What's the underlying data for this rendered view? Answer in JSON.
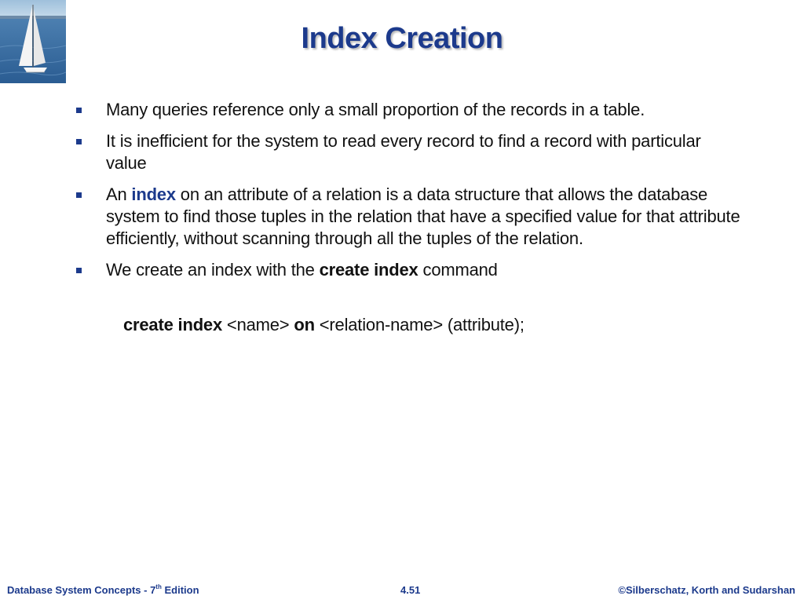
{
  "colors": {
    "title": "#1c3a8c",
    "bullet_marker": "#1c3a8c",
    "keyword_blue": "#1c3a8c",
    "footer": "#1c3a8c",
    "text": "#111111"
  },
  "slide": {
    "title": "Index Creation",
    "bullets": [
      {
        "text": "Many queries reference only a small proportion of the records in a table."
      },
      {
        "text": "It is inefficient for the system to read every record to find  a record with particular value"
      },
      {
        "pre": "An ",
        "keyword": "index",
        "post": " on an attribute of a relation is a data structure that allows the database system to find those tuples in the relation that have a specified value for that attribute efficiently, without scanning through all the tuples of the relation."
      },
      {
        "pre": "We create an index with the ",
        "keyword": "create index",
        "post": " command"
      }
    ],
    "code": {
      "kw1": "create index",
      "mid1": " <name> ",
      "kw2": "on",
      "mid2": " <relation-name> (attribute);"
    }
  },
  "footer": {
    "left": "Database System Concepts - 7",
    "left_sup": "th",
    "left_end": " Edition",
    "center": "4.51",
    "right": "©Silberschatz, Korth and Sudarshan"
  }
}
